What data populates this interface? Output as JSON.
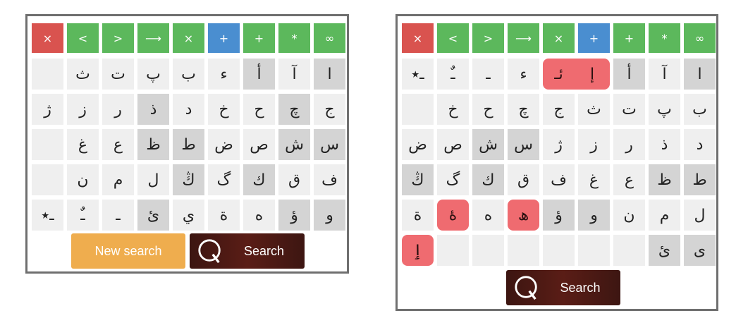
{
  "left_panel": {
    "controls": [
      {
        "label": "×",
        "color": "red"
      },
      {
        "label": "<",
        "color": "green"
      },
      {
        "label": ">",
        "color": "green"
      },
      {
        "label": "⟶",
        "color": "green"
      },
      {
        "label": "×",
        "color": "green"
      },
      {
        "label": "+",
        "color": "blue"
      },
      {
        "label": "+",
        "color": "green"
      },
      {
        "label": "*",
        "color": "green"
      },
      {
        "label": "∞",
        "color": "green"
      }
    ],
    "rows": [
      [
        {
          "t": "",
          "s": "empty"
        },
        {
          "t": "ث",
          "s": "light"
        },
        {
          "t": "ت",
          "s": "light"
        },
        {
          "t": "پ",
          "s": "light"
        },
        {
          "t": "ب",
          "s": "light"
        },
        {
          "t": "ء",
          "s": "light"
        },
        {
          "t": "أ",
          "s": "dark"
        },
        {
          "t": "آ",
          "s": "light"
        },
        {
          "t": "ا",
          "s": "dark"
        }
      ],
      [
        {
          "t": "ژ",
          "s": "light"
        },
        {
          "t": "ز",
          "s": "light"
        },
        {
          "t": "ر",
          "s": "light"
        },
        {
          "t": "ذ",
          "s": "dark"
        },
        {
          "t": "د",
          "s": "light"
        },
        {
          "t": "خ",
          "s": "light"
        },
        {
          "t": "ح",
          "s": "light"
        },
        {
          "t": "چ",
          "s": "dark"
        },
        {
          "t": "ج",
          "s": "light"
        }
      ],
      [
        {
          "t": "",
          "s": "empty"
        },
        {
          "t": "غ",
          "s": "light"
        },
        {
          "t": "ع",
          "s": "light"
        },
        {
          "t": "ظ",
          "s": "dark"
        },
        {
          "t": "ط",
          "s": "dark"
        },
        {
          "t": "ض",
          "s": "light"
        },
        {
          "t": "ص",
          "s": "light"
        },
        {
          "t": "ش",
          "s": "dark"
        },
        {
          "t": "س",
          "s": "dark"
        }
      ],
      [
        {
          "t": "",
          "s": "empty"
        },
        {
          "t": "ن",
          "s": "light"
        },
        {
          "t": "م",
          "s": "light"
        },
        {
          "t": "ل",
          "s": "light"
        },
        {
          "t": "ڭ",
          "s": "dark"
        },
        {
          "t": "گ",
          "s": "light"
        },
        {
          "t": "ك",
          "s": "dark"
        },
        {
          "t": "ق",
          "s": "light"
        },
        {
          "t": "ف",
          "s": "light"
        }
      ],
      [
        {
          "t": "ـ٭",
          "s": "light"
        },
        {
          "t": "ـٌ",
          "s": "light"
        },
        {
          "t": "ـ",
          "s": "light"
        },
        {
          "t": "ئ",
          "s": "dark"
        },
        {
          "t": "ي",
          "s": "light"
        },
        {
          "t": "ة",
          "s": "light"
        },
        {
          "t": "ه",
          "s": "light"
        },
        {
          "t": "ؤ",
          "s": "dark"
        },
        {
          "t": "و",
          "s": "dark"
        }
      ]
    ],
    "new_search_label": "New search",
    "search_label": "Search"
  },
  "right_panel": {
    "controls": [
      {
        "label": "×",
        "color": "red"
      },
      {
        "label": "<",
        "color": "green"
      },
      {
        "label": ">",
        "color": "green"
      },
      {
        "label": "⟶",
        "color": "green"
      },
      {
        "label": "×",
        "color": "green"
      },
      {
        "label": "+",
        "color": "blue"
      },
      {
        "label": "+",
        "color": "green"
      },
      {
        "label": "*",
        "color": "green"
      },
      {
        "label": "∞",
        "color": "green"
      }
    ],
    "rows": [
      [
        {
          "t": "ـ٭",
          "s": "light"
        },
        {
          "t": "ـٌ",
          "s": "light"
        },
        {
          "t": "ـ",
          "s": "light"
        },
        {
          "t": "ء",
          "s": "light"
        },
        {
          "t": "ئـ",
          "s": "hl hl-l"
        },
        {
          "t": "إ",
          "s": "hl hl-r"
        },
        {
          "t": "أ",
          "s": "dark"
        },
        {
          "t": "آ",
          "s": "light"
        },
        {
          "t": "ا",
          "s": "dark"
        }
      ],
      [
        {
          "t": "",
          "s": "empty"
        },
        {
          "t": "خ",
          "s": "light"
        },
        {
          "t": "ح",
          "s": "light"
        },
        {
          "t": "چ",
          "s": "light"
        },
        {
          "t": "ج",
          "s": "light"
        },
        {
          "t": "ث",
          "s": "light"
        },
        {
          "t": "ت",
          "s": "light"
        },
        {
          "t": "پ",
          "s": "light"
        },
        {
          "t": "ب",
          "s": "light"
        }
      ],
      [
        {
          "t": "ض",
          "s": "light"
        },
        {
          "t": "ص",
          "s": "light"
        },
        {
          "t": "ش",
          "s": "dark"
        },
        {
          "t": "س",
          "s": "dark"
        },
        {
          "t": "ژ",
          "s": "light"
        },
        {
          "t": "ز",
          "s": "light"
        },
        {
          "t": "ر",
          "s": "light"
        },
        {
          "t": "ذ",
          "s": "light"
        },
        {
          "t": "د",
          "s": "light"
        }
      ],
      [
        {
          "t": "ڭ",
          "s": "dark"
        },
        {
          "t": "گ",
          "s": "light"
        },
        {
          "t": "ك",
          "s": "dark"
        },
        {
          "t": "ق",
          "s": "light"
        },
        {
          "t": "ف",
          "s": "light"
        },
        {
          "t": "غ",
          "s": "light"
        },
        {
          "t": "ع",
          "s": "light"
        },
        {
          "t": "ظ",
          "s": "dark"
        },
        {
          "t": "ط",
          "s": "dark"
        }
      ],
      [
        {
          "t": "ة",
          "s": "light"
        },
        {
          "t": "ۀ",
          "s": "hl"
        },
        {
          "t": "ه",
          "s": "light"
        },
        {
          "t": "ھ",
          "s": "hl"
        },
        {
          "t": "ؤ",
          "s": "dark"
        },
        {
          "t": "و",
          "s": "dark"
        },
        {
          "t": "ن",
          "s": "light"
        },
        {
          "t": "م",
          "s": "light"
        },
        {
          "t": "ل",
          "s": "light"
        }
      ],
      [
        {
          "t": "ٳ",
          "s": "hl"
        },
        {
          "t": "",
          "s": "empty"
        },
        {
          "t": "",
          "s": "empty"
        },
        {
          "t": "",
          "s": "empty"
        },
        {
          "t": "",
          "s": "empty"
        },
        {
          "t": "",
          "s": "empty"
        },
        {
          "t": "",
          "s": "empty"
        },
        {
          "t": "ئ",
          "s": "dark"
        },
        {
          "t": "ى",
          "s": "dark"
        }
      ]
    ],
    "search_label": "Search"
  }
}
